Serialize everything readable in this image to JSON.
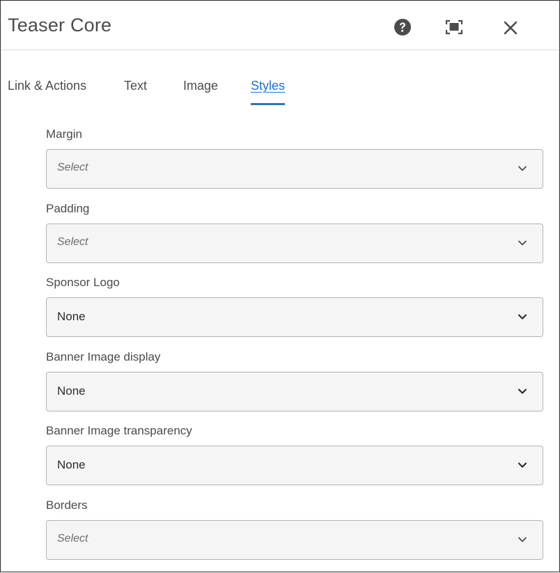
{
  "dialog": {
    "title": "Teaser Core",
    "header_icons": [
      "help-icon",
      "fullscreen-icon",
      "close-icon"
    ]
  },
  "tabs": [
    {
      "label": "Link & Actions",
      "active": false
    },
    {
      "label": "Text",
      "active": false
    },
    {
      "label": "Image",
      "active": false
    },
    {
      "label": "Styles",
      "active": true
    }
  ],
  "fields": [
    {
      "label": "Margin",
      "value": "Select",
      "placeholder": true
    },
    {
      "label": "Padding",
      "value": "Select",
      "placeholder": true
    },
    {
      "label": "Sponsor Logo",
      "value": "None",
      "placeholder": false
    },
    {
      "label": "Banner Image display",
      "value": "None",
      "placeholder": false
    },
    {
      "label": "Banner Image transparency",
      "value": "None",
      "placeholder": false
    },
    {
      "label": "Borders",
      "value": "Select",
      "placeholder": true
    }
  ],
  "colors": {
    "accent": "#1473e6",
    "tab_underline": "#2c76c0",
    "text": "#4b4b4b",
    "field_bg": "#f5f5f5",
    "field_border": "#b3b3b3"
  }
}
